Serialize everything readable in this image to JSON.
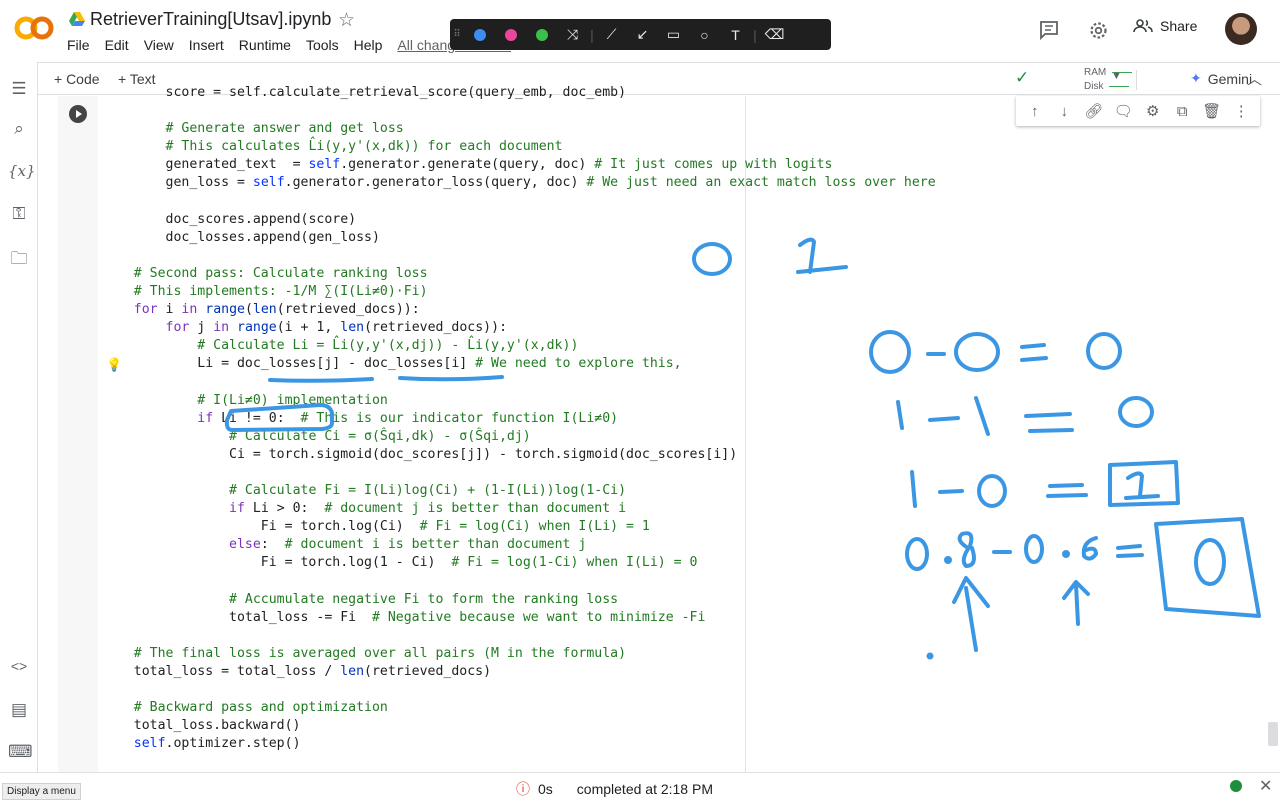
{
  "header": {
    "title": "RetrieverTraining[Utsav].ipynb",
    "menu": [
      "File",
      "Edit",
      "View",
      "Insert",
      "Runtime",
      "Tools",
      "Help"
    ],
    "changes_label": "All changes saved",
    "share_label": "Share"
  },
  "toolbar": {
    "add_code_label": "+ Code",
    "add_text_label": "+ Text",
    "ram_label": "RAM",
    "disk_label": "Disk",
    "gemini_label": "Gemini"
  },
  "code_lines": [
    {
      "indent": "        ",
      "parts": [
        [
          "score = self.calculate_retrieval_score(query_emb, doc_emb)",
          ""
        ]
      ]
    },
    {
      "indent": "",
      "parts": [
        [
          "",
          ""
        ]
      ]
    },
    {
      "indent": "        ",
      "parts": [
        [
          "# Generate answer and get loss",
          "c-com"
        ]
      ]
    },
    {
      "indent": "        ",
      "parts": [
        [
          "# This calculates L̂i(y,y'(x,dk)) for each document",
          "c-com"
        ]
      ]
    },
    {
      "indent": "        ",
      "parts": [
        [
          "generated_text  = ",
          ""
        ],
        [
          "self",
          "c-self"
        ],
        [
          ".generator.generate(query, doc) ",
          ""
        ],
        [
          "# It just comes up with logits",
          "c-com"
        ]
      ]
    },
    {
      "indent": "        ",
      "parts": [
        [
          "gen_loss = ",
          ""
        ],
        [
          "self",
          "c-self"
        ],
        [
          ".generator.generator_loss(query, doc) ",
          ""
        ],
        [
          "# We just need an exact match loss over here",
          "c-com"
        ]
      ]
    },
    {
      "indent": "",
      "parts": [
        [
          "",
          ""
        ]
      ]
    },
    {
      "indent": "        ",
      "parts": [
        [
          "doc_scores.append(score)",
          ""
        ]
      ]
    },
    {
      "indent": "        ",
      "parts": [
        [
          "doc_losses.append(gen_loss)",
          ""
        ]
      ]
    },
    {
      "indent": "",
      "parts": [
        [
          "",
          ""
        ]
      ]
    },
    {
      "indent": "    ",
      "parts": [
        [
          "# Second pass: Calculate ranking loss",
          "c-com"
        ]
      ]
    },
    {
      "indent": "    ",
      "parts": [
        [
          "# This implements: -1/M ∑(I(Li≠0)·Fi)",
          "c-com"
        ]
      ]
    },
    {
      "indent": "    ",
      "parts": [
        [
          "for",
          "c-kw"
        ],
        [
          " i ",
          ""
        ],
        [
          "in",
          "c-kw"
        ],
        [
          " ",
          ""
        ],
        [
          "range",
          "c-kw2"
        ],
        [
          "(",
          ""
        ],
        [
          "len",
          "c-kw2"
        ],
        [
          "(retrieved_docs)):",
          ""
        ]
      ]
    },
    {
      "indent": "        ",
      "parts": [
        [
          "for",
          "c-kw"
        ],
        [
          " j ",
          ""
        ],
        [
          "in",
          "c-kw"
        ],
        [
          " ",
          ""
        ],
        [
          "range",
          "c-kw2"
        ],
        [
          "(i + 1, ",
          ""
        ],
        [
          "len",
          "c-kw2"
        ],
        [
          "(retrieved_docs)):",
          ""
        ]
      ]
    },
    {
      "indent": "            ",
      "parts": [
        [
          "# Calculate Li = L̂i(y,y'(x,dj)) - L̂i(y,y'(x,dk))",
          "c-com"
        ]
      ]
    },
    {
      "indent": "            ",
      "parts": [
        [
          "Li = doc_losses[j] - doc_losses[i] ",
          ""
        ],
        [
          "# We need to explore this,",
          "c-com"
        ]
      ]
    },
    {
      "indent": "",
      "parts": [
        [
          "",
          ""
        ]
      ]
    },
    {
      "indent": "            ",
      "parts": [
        [
          "# I(Li≠0) implementation",
          "c-com"
        ]
      ]
    },
    {
      "indent": "            ",
      "parts": [
        [
          "if",
          "c-kw"
        ],
        [
          " Li != 0:  ",
          ""
        ],
        [
          "# This is our indicator function I(Li≠0)",
          "c-com"
        ]
      ]
    },
    {
      "indent": "                ",
      "parts": [
        [
          "# Calculate Ci = σ(Ŝqi,dk) - σ(Ŝqi,dj)",
          "c-com"
        ]
      ]
    },
    {
      "indent": "                ",
      "parts": [
        [
          "Ci = torch.sigmoid(doc_scores[j]) - torch.sigmoid(doc_scores[i])",
          ""
        ]
      ]
    },
    {
      "indent": "",
      "parts": [
        [
          "",
          ""
        ]
      ]
    },
    {
      "indent": "                ",
      "parts": [
        [
          "# Calculate Fi = I(Li)log(Ci) + (1-I(Li))log(1-Ci)",
          "c-com"
        ]
      ]
    },
    {
      "indent": "                ",
      "parts": [
        [
          "if",
          "c-kw"
        ],
        [
          " Li > 0:  ",
          ""
        ],
        [
          "# document j is better than document i",
          "c-com"
        ]
      ]
    },
    {
      "indent": "                    ",
      "parts": [
        [
          "Fi = torch.log(Ci)  ",
          ""
        ],
        [
          "# Fi = log(Ci) when I(Li) = 1",
          "c-com"
        ]
      ]
    },
    {
      "indent": "                ",
      "parts": [
        [
          "else",
          "c-kw"
        ],
        [
          ":  ",
          ""
        ],
        [
          "# document i is better than document j",
          "c-com"
        ]
      ]
    },
    {
      "indent": "                    ",
      "parts": [
        [
          "Fi = torch.log(1 - Ci)  ",
          ""
        ],
        [
          "# Fi = log(1-Ci) when I(Li) = 0",
          "c-com"
        ]
      ]
    },
    {
      "indent": "",
      "parts": [
        [
          "",
          ""
        ]
      ]
    },
    {
      "indent": "                ",
      "parts": [
        [
          "# Accumulate negative Fi to form the ranking loss",
          "c-com"
        ]
      ]
    },
    {
      "indent": "                ",
      "parts": [
        [
          "total_loss -= Fi  ",
          ""
        ],
        [
          "# Negative because we want to minimize -Fi",
          "c-com"
        ]
      ]
    },
    {
      "indent": "",
      "parts": [
        [
          "",
          ""
        ]
      ]
    },
    {
      "indent": "    ",
      "parts": [
        [
          "# The final loss is averaged over all pairs (M in the formula)",
          "c-com"
        ]
      ]
    },
    {
      "indent": "    ",
      "parts": [
        [
          "total_loss = total_loss / ",
          ""
        ],
        [
          "len",
          "c-kw2"
        ],
        [
          "(retrieved_docs)",
          ""
        ]
      ]
    },
    {
      "indent": "",
      "parts": [
        [
          "",
          ""
        ]
      ]
    },
    {
      "indent": "    ",
      "parts": [
        [
          "# Backward pass and optimization",
          "c-com"
        ]
      ]
    },
    {
      "indent": "    ",
      "parts": [
        [
          "total_loss.backward()",
          ""
        ]
      ]
    },
    {
      "indent": "    ",
      "parts": [
        [
          "self",
          "c-self"
        ],
        [
          ".optimizer.step()",
          ""
        ]
      ]
    }
  ],
  "status": {
    "time": "0s",
    "message": "completed at 2:18 PM",
    "display_menu": "Display a menu"
  },
  "ink": {
    "color": "#3b97e3",
    "labels": [
      "0",
      "1",
      "0-0 = 0",
      "1-1 = 0",
      "1-0 = 1",
      "0.8-0.6 = 0"
    ]
  },
  "colors": {
    "accent_orange": "#f9ab00",
    "ink_blue": "#3b97e3",
    "status_green": "#1e8e3e"
  }
}
